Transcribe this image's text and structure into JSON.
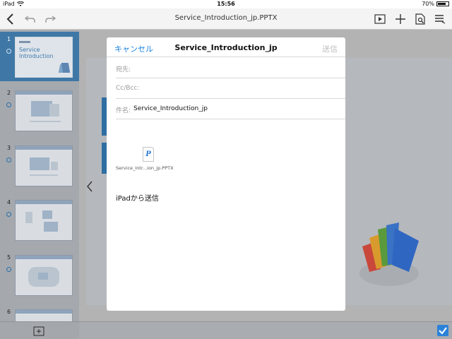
{
  "status_bar": {
    "device": "iPad",
    "time": "15:56",
    "battery": "70%"
  },
  "toolbar": {
    "document_title": "Service_Introduction_jp.PPTX"
  },
  "sidebar": {
    "slides": [
      {
        "number": "1",
        "title": "Service Introduction",
        "selected": true
      },
      {
        "number": "2",
        "selected": false
      },
      {
        "number": "3",
        "selected": false
      },
      {
        "number": "4",
        "selected": false
      },
      {
        "number": "5",
        "selected": false
      },
      {
        "number": "6",
        "selected": false
      }
    ]
  },
  "composer": {
    "cancel_label": "キャンセル",
    "title": "Service_Introduction_jp",
    "send_label": "送信",
    "to_label": "宛先:",
    "ccbcc_label": "Cc/Bcc:",
    "subject_label": "件名:",
    "subject_value": "Service_Introduction_jp",
    "attachment_icon_letter": "P",
    "attachment_name": "Service_Intr...ion_jp.PPTX",
    "signature": "iPadから送信"
  },
  "colors": {
    "accent_blue": "#1a82e0",
    "send_disabled": "#bdbdbd",
    "selected_slide": "#3f78a6"
  }
}
